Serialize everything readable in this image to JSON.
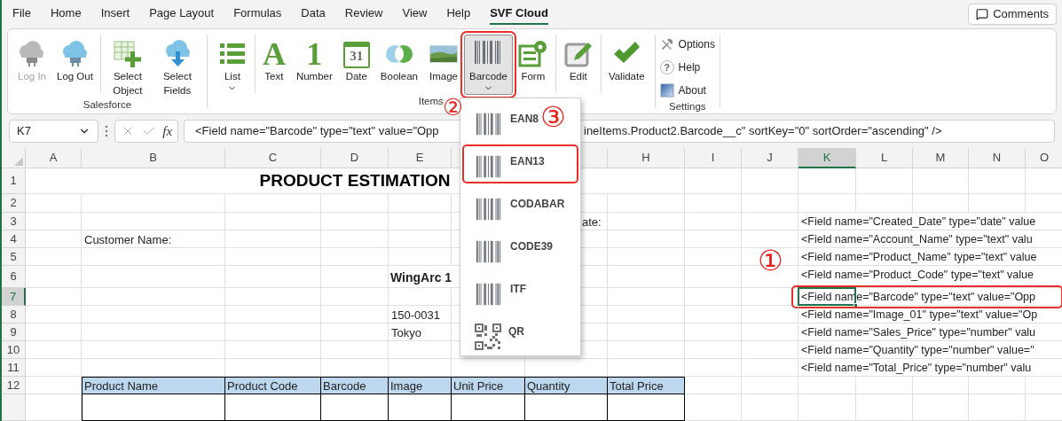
{
  "menu_tabs": [
    {
      "label": "File",
      "selected": false
    },
    {
      "label": "Home",
      "selected": false
    },
    {
      "label": "Insert",
      "selected": false
    },
    {
      "label": "Page Layout",
      "selected": false
    },
    {
      "label": "Formulas",
      "selected": false
    },
    {
      "label": "Data",
      "selected": false
    },
    {
      "label": "Review",
      "selected": false
    },
    {
      "label": "View",
      "selected": false
    },
    {
      "label": "Help",
      "selected": false
    },
    {
      "label": "SVF Cloud",
      "selected": true
    }
  ],
  "comments_button": {
    "label": "Comments"
  },
  "ribbon_groups": [
    {
      "label": "Salesforce",
      "sections": [
        [
          {
            "kind": "log-in",
            "label": "Log In",
            "disabled": true,
            "selected": false,
            "highlighted": false,
            "dropdown": false
          },
          {
            "kind": "log-out",
            "label": "Log Out",
            "disabled": false,
            "selected": false,
            "highlighted": false,
            "dropdown": false
          }
        ],
        [
          {
            "kind": "select-object",
            "label": "Select Object",
            "disabled": false,
            "selected": false,
            "highlighted": false,
            "dropdown": false
          },
          {
            "kind": "select-fields",
            "label": "Select Fields",
            "disabled": false,
            "selected": false,
            "highlighted": false,
            "dropdown": false
          }
        ]
      ]
    },
    {
      "label": "Items",
      "sections": [
        [
          {
            "kind": "list",
            "label": "List",
            "disabled": false,
            "selected": false,
            "highlighted": false,
            "dropdown": true
          }
        ],
        [
          {
            "kind": "text",
            "label": "Text",
            "icon_text": "A",
            "disabled": false,
            "selected": false,
            "highlighted": false,
            "dropdown": false
          },
          {
            "kind": "number",
            "label": "Number",
            "icon_text": "1",
            "disabled": false,
            "selected": false,
            "highlighted": false,
            "dropdown": false
          },
          {
            "kind": "date",
            "label": "Date",
            "icon_text": "31",
            "disabled": false,
            "selected": false,
            "highlighted": false,
            "dropdown": false
          },
          {
            "kind": "boolean",
            "label": "Boolean",
            "disabled": false,
            "selected": false,
            "highlighted": false,
            "dropdown": false
          },
          {
            "kind": "image",
            "label": "Image",
            "disabled": false,
            "selected": false,
            "highlighted": false,
            "dropdown": false
          },
          {
            "kind": "barcode",
            "label": "Barcode",
            "disabled": false,
            "selected": true,
            "highlighted": true,
            "dropdown": true
          },
          {
            "kind": "form",
            "label": "Form",
            "disabled": false,
            "selected": false,
            "highlighted": false,
            "dropdown": false
          }
        ],
        [
          {
            "kind": "edit",
            "label": "Edit",
            "disabled": false,
            "selected": false,
            "highlighted": false,
            "dropdown": false
          }
        ],
        [
          {
            "kind": "validate",
            "label": "Validate",
            "disabled": false,
            "selected": false,
            "highlighted": false,
            "dropdown": false
          }
        ]
      ]
    },
    {
      "label": "Settings",
      "small_buttons": [
        {
          "kind": "options",
          "label": "Options"
        },
        {
          "kind": "help",
          "label": "Help",
          "icon_text": "?"
        },
        {
          "kind": "about",
          "label": "About"
        }
      ]
    }
  ],
  "formula_bar": {
    "name_box": "K7",
    "fx": "fx",
    "formula_start": "<Field name=\"Barcode\" type=\"text\" value=\"Opp",
    "formula_end": "ineItems.Product2.Barcode__c\" sortKey=\"0\" sortOrder=\"ascending\" />"
  },
  "barcode_menu": [
    {
      "kind": "barcode",
      "label": "EAN8",
      "highlighted": false
    },
    {
      "kind": "barcode",
      "label": "EAN13",
      "highlighted": true
    },
    {
      "kind": "barcode",
      "label": "CODABAR",
      "highlighted": false
    },
    {
      "kind": "barcode",
      "label": "CODE39",
      "highlighted": false
    },
    {
      "kind": "barcode",
      "label": "ITF",
      "highlighted": false
    },
    {
      "kind": "qr",
      "label": "QR",
      "highlighted": false
    }
  ],
  "callouts": [
    {
      "text": "②"
    },
    {
      "text": "③"
    },
    {
      "text": "①"
    }
  ],
  "sheet": {
    "columns": [
      {
        "label": "A",
        "selected": false
      },
      {
        "label": "B",
        "selected": false
      },
      {
        "label": "C",
        "selected": false
      },
      {
        "label": "D",
        "selected": false
      },
      {
        "label": "E",
        "selected": false
      },
      {
        "selected": false
      },
      {
        "selected": false
      },
      {
        "label": "H",
        "selected": false
      },
      {
        "label": "I",
        "selected": false
      },
      {
        "label": "J",
        "selected": false
      },
      {
        "label": "K",
        "selected": true
      },
      {
        "label": "L",
        "selected": false
      },
      {
        "label": "M",
        "selected": false
      },
      {
        "label": "N",
        "selected": false
      },
      {
        "label": "O",
        "selected": false
      }
    ],
    "rows": [
      {
        "label": "1",
        "selected": false
      },
      {
        "label": "2",
        "selected": false
      },
      {
        "label": "3",
        "selected": false
      },
      {
        "label": "4",
        "selected": false
      },
      {
        "label": "5",
        "selected": false
      },
      {
        "label": "6",
        "selected": false
      },
      {
        "label": "7",
        "selected": true
      },
      {
        "label": "8",
        "selected": false
      },
      {
        "label": "9",
        "selected": false
      },
      {
        "label": "10",
        "selected": false
      },
      {
        "label": "11",
        "selected": false
      },
      {
        "label": "12",
        "selected": false
      }
    ],
    "title": "PRODUCT ESTIMATION",
    "date_label": "ate:",
    "customer_label": "Customer Name:",
    "company": "WingArc 1",
    "postal_code": "150-0031",
    "city": "Tokyo",
    "field_tags": [
      {
        "text": "<Field name=\"Created_Date\" type=\"date\" value",
        "selected": false,
        "highlighted": false
      },
      {
        "text": "<Field name=\"Account_Name\" type=\"text\" valu",
        "selected": false,
        "highlighted": false
      },
      {
        "text": "<Field name=\"Product_Name\" type=\"text\" value",
        "selected": false,
        "highlighted": false
      },
      {
        "text": "<Field name=\"Product_Code\" type=\"text\" value",
        "selected": false,
        "highlighted": false
      },
      {
        "text": "<Field name=\"Barcode\" type=\"text\" value=\"Opp",
        "selected": true,
        "highlighted": true
      },
      {
        "text": "<Field name=\"Image_01\" type=\"text\" value=\"Op",
        "selected": false,
        "highlighted": false
      },
      {
        "text": "<Field name=\"Sales_Price\" type=\"number\" valu",
        "selected": false,
        "highlighted": false
      },
      {
        "text": "<Field name=\"Quantity\" type=\"number\" value=\"",
        "selected": false,
        "highlighted": false
      },
      {
        "text": "<Field name=\"Total_Price\" type=\"number\" valu",
        "selected": false,
        "highlighted": false
      }
    ],
    "table_headers": [
      "Product Name",
      "Product Code",
      "Barcode",
      "Image",
      "Unit Price",
      "Quantity",
      "Total Price"
    ]
  }
}
